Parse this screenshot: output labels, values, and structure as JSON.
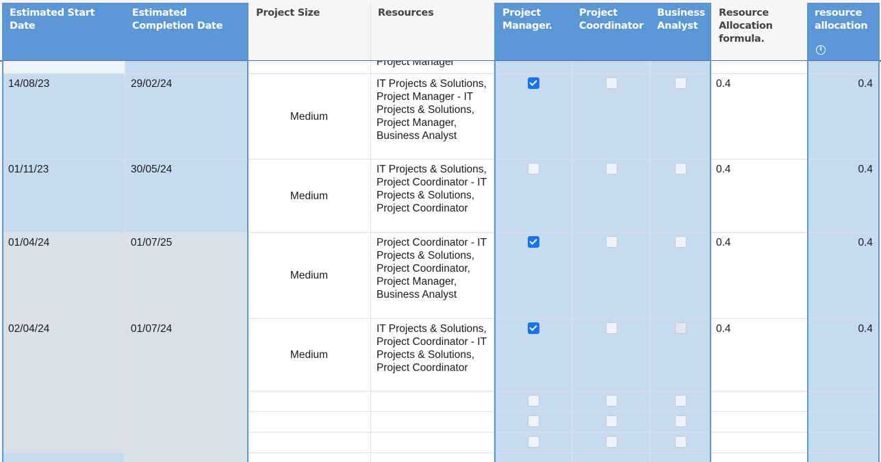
{
  "columns": {
    "start_date": "Estimated Start Date",
    "completion_date": "Estimated Completion Date",
    "project_size": "Project Size",
    "resources": "Resources",
    "project_manager": "Project Manager.",
    "project_coordinator": "Project Coordinator",
    "business_analyst": "Business Analyst",
    "resource_allocation_formula": "Resource Allocation formula.",
    "resource_allocation": "resource allocation"
  },
  "partial_row": {
    "resources_tail": "Project Manager"
  },
  "rows": [
    {
      "start_date": "14/08/23",
      "completion_date": "29/02/24",
      "project_size": "Medium",
      "resources": "IT Projects & Solutions, Project Manager - IT Projects & Solutions, Project Manager, Business Analyst",
      "project_manager": true,
      "project_coordinator": false,
      "business_analyst": false,
      "resource_allocation_formula": "0.4",
      "resource_allocation": "0.4"
    },
    {
      "start_date": "01/11/23",
      "completion_date": "30/05/24",
      "project_size": "Medium",
      "resources": "IT Projects & Solutions, Project Coordinator - IT Projects & Solutions, Project Coordinator",
      "project_manager": false,
      "project_coordinator": false,
      "business_analyst": false,
      "resource_allocation_formula": "0.4",
      "resource_allocation": "0.4"
    },
    {
      "start_date": "01/04/24",
      "completion_date": "01/07/25",
      "project_size": "Medium",
      "resources": "Project Coordinator - IT Projects & Solutions, Project Coordinator, Project Manager, Business Analyst",
      "project_manager": true,
      "project_coordinator": false,
      "business_analyst": false,
      "resource_allocation_formula": "0.4",
      "resource_allocation": "0.4"
    },
    {
      "start_date": "02/04/24",
      "completion_date": "01/07/24",
      "project_size": "Medium",
      "resources": "IT Projects & Solutions, Project Coordinator - IT Projects & Solutions, Project Coordinator",
      "project_manager": true,
      "project_coordinator": false,
      "business_analyst": false,
      "business_analyst_disabled": true,
      "resource_allocation_formula": "0.4",
      "resource_allocation": "0.4"
    }
  ],
  "empty_rows": 3,
  "colors": {
    "header_blue": "#5b97d5",
    "selected_cell": "#c6dbf0",
    "checkbox_checked": "#1a73e8"
  }
}
